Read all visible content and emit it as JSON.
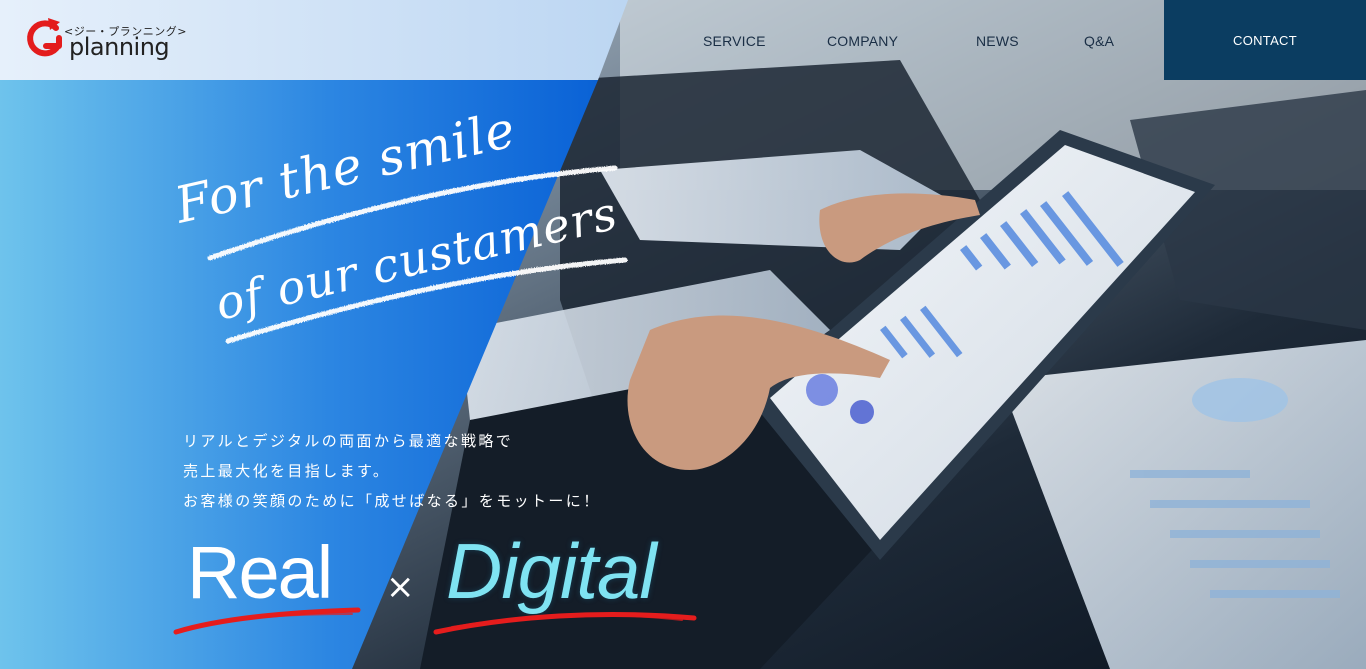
{
  "brand": {
    "sub": "<ジー・プランニング>",
    "name": "planning"
  },
  "nav": {
    "items": [
      {
        "label": "SERVICE"
      },
      {
        "label": "COMPANY"
      },
      {
        "label": "NEWS"
      },
      {
        "label": "Q&A"
      }
    ],
    "contact": "CONTACT"
  },
  "hero": {
    "tagline": {
      "line1": "For the smile",
      "line2": "of our custamers"
    },
    "copy": [
      "リアルとデジタルの両面から最適な戦略で",
      "売上最大化を目指します。",
      "お客様の笑顔のために「成せばなる」をモットーに！"
    ],
    "real": "Real",
    "times": "×",
    "digital": "Digital"
  },
  "colors": {
    "header_left": "#e6f0fb",
    "hero_blue_left": "#6ec3ec",
    "hero_blue_right": "#0a62d6",
    "contact_bg": "#0b3d61",
    "logo_red": "#e31c1c",
    "underline_red": "#e51d1d",
    "digital_text": "#7fe3f2"
  }
}
